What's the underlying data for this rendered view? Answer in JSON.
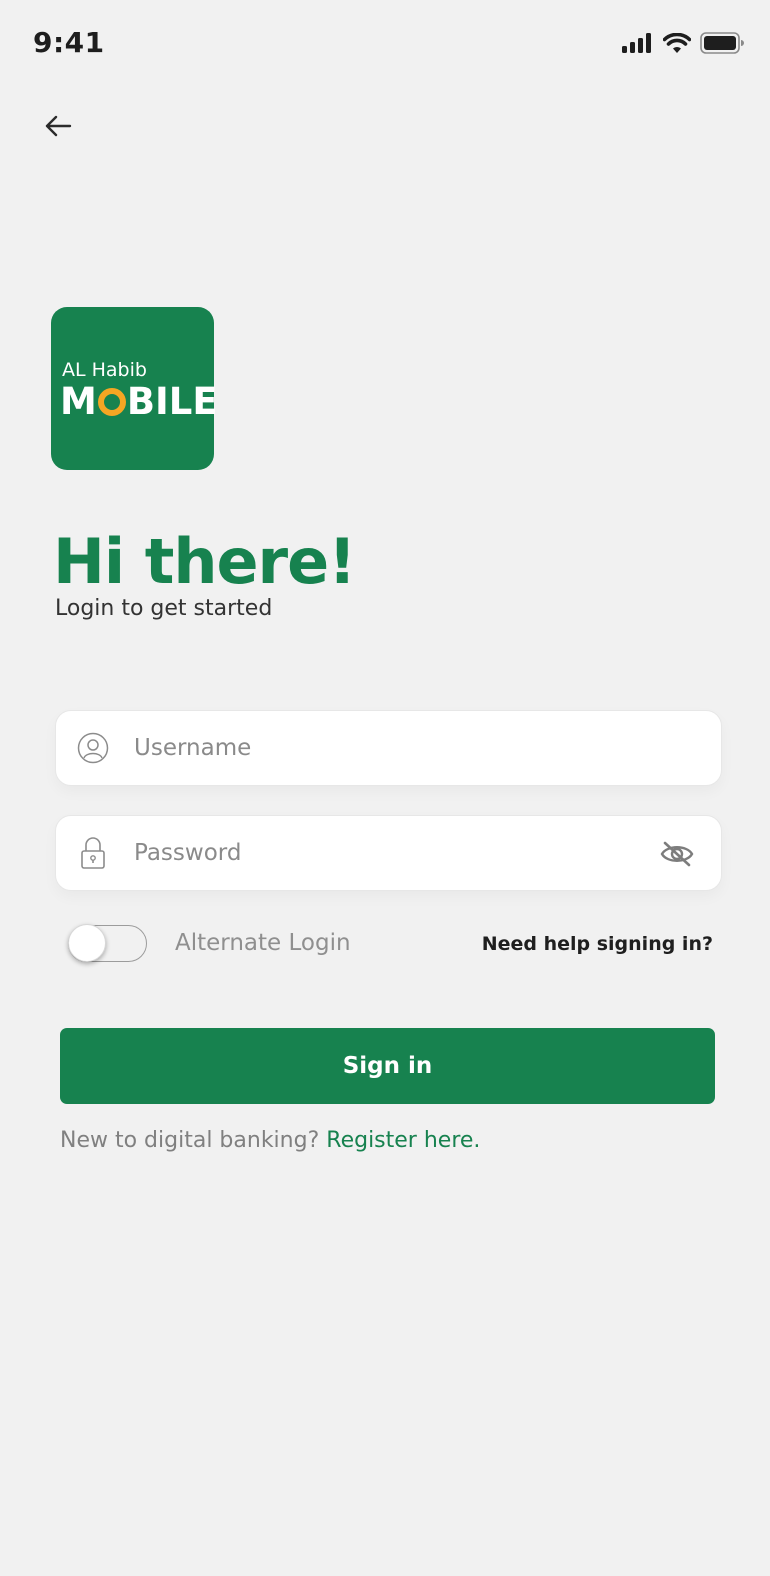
{
  "status_bar": {
    "time": "9:41",
    "icons": [
      "signal-icon",
      "wifi-icon",
      "battery-icon"
    ]
  },
  "nav": {
    "back_icon": "arrow-left-icon"
  },
  "logo": {
    "line1": "AL Habib",
    "line2_prefix": "M",
    "line2_suffix": "BILE",
    "bg_color": "#17824f",
    "accent_color": "#f5a623"
  },
  "header": {
    "title": "Hi there!",
    "subtitle": "Login to get started"
  },
  "form": {
    "username": {
      "placeholder": "Username",
      "value": "",
      "icon": "user-circle-icon"
    },
    "password": {
      "placeholder": "Password",
      "value": "",
      "icon": "lock-icon",
      "visibility_icon": "eye-off-icon"
    },
    "alternate_login": {
      "label": "Alternate Login",
      "enabled": false
    },
    "help_link": "Need help signing in?",
    "submit_label": "Sign in"
  },
  "register": {
    "prompt": "New to digital banking?",
    "link": "Register here."
  },
  "colors": {
    "brand_green": "#17824f",
    "background": "#f1f1f1"
  }
}
